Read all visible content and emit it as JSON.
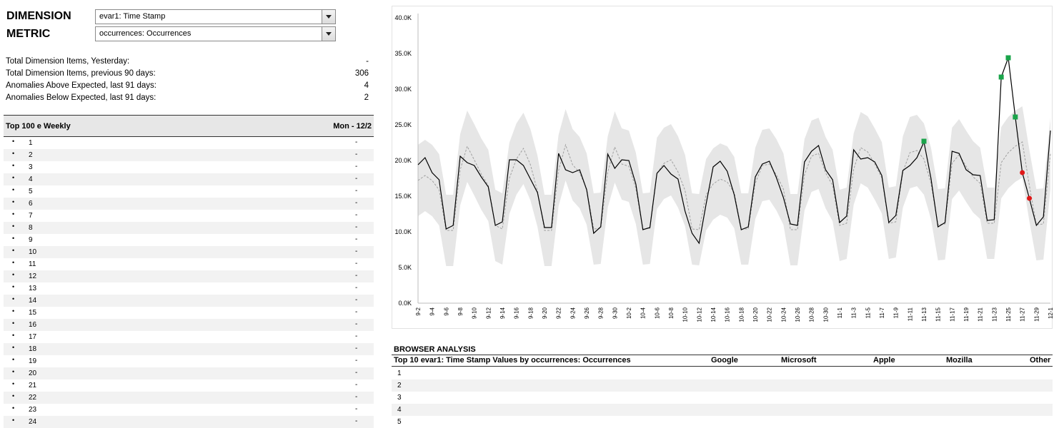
{
  "header": {
    "dimension_label": "DIMENSION",
    "metric_label": "METRIC",
    "dimension_value": "evar1: Time Stamp",
    "metric_value": "occurrences: Occurrences"
  },
  "stats": [
    {
      "label": "Total Dimension Items, Yesterday:",
      "value": "-"
    },
    {
      "label": "Total Dimension Items, previous 90 days:",
      "value": "306"
    },
    {
      "label": "Anomalies Above Expected, last 91 days:",
      "value": "4"
    },
    {
      "label": "Anomalies Below Expected, last 91 days:",
      "value": "2"
    }
  ],
  "top_table": {
    "title": "Top 100 e Weekly",
    "column": "Mon - 12/2",
    "bullet": "•",
    "empty_value": "-",
    "rows": [
      "1",
      "2",
      "3",
      "4",
      "5",
      "6",
      "7",
      "8",
      "9",
      "10",
      "11",
      "12",
      "13",
      "14",
      "15",
      "16",
      "17",
      "18",
      "19",
      "20",
      "21",
      "22",
      "23",
      "24"
    ]
  },
  "chart_data": {
    "type": "line",
    "ylim": [
      0,
      40000
    ],
    "yticks": [
      "0.0K",
      "5.0K",
      "10.0K",
      "15.0K",
      "20.0K",
      "25.0K",
      "30.0K",
      "35.0K",
      "40.0K"
    ],
    "xticks": [
      "9-2",
      "9-4",
      "9-6",
      "9-8",
      "9-10",
      "9-12",
      "9-14",
      "9-16",
      "9-18",
      "9-20",
      "9-22",
      "9-24",
      "9-26",
      "9-28",
      "9-30",
      "10-2",
      "10-4",
      "10-6",
      "10-8",
      "10-10",
      "10-12",
      "10-14",
      "10-16",
      "10-18",
      "10-20",
      "10-22",
      "10-24",
      "10-26",
      "10-28",
      "10-30",
      "11-1",
      "11-3",
      "11-5",
      "11-7",
      "11-9",
      "11-11",
      "11-13",
      "11-15",
      "11-17",
      "11-19",
      "11-21",
      "11-23",
      "11-25",
      "11-27",
      "11-29",
      "12-1"
    ],
    "grid": false,
    "series": [
      {
        "style": "actual",
        "color": "#000000",
        "values": [
          19400,
          20400,
          18300,
          17300,
          10400,
          10900,
          20600,
          19700,
          19300,
          17700,
          16300,
          10900,
          11400,
          20100,
          20100,
          19300,
          17400,
          15500,
          10600,
          10600,
          21000,
          18700,
          18300,
          18700,
          15900,
          9800,
          10700,
          20900,
          18900,
          20100,
          20000,
          16700,
          10300,
          10600,
          18200,
          19300,
          18100,
          17400,
          12900,
          9800,
          8400,
          13900,
          19100,
          19900,
          18500,
          15200,
          10300,
          10700,
          17700,
          19500,
          19900,
          17600,
          14800,
          11100,
          10900,
          19800,
          21300,
          22100,
          18700,
          17300,
          11300,
          12200,
          21500,
          20200,
          20400,
          19800,
          17900,
          11300,
          12300,
          18600,
          19300,
          20400,
          22600,
          17500,
          10700,
          11300,
          21300,
          21000,
          18700,
          18000,
          17900,
          11600,
          11700,
          31700,
          34400,
          26100,
          18300,
          14700,
          10900,
          12100,
          24200
        ]
      },
      {
        "style": "expected",
        "color": "#a0a0a0",
        "values": [
          17200,
          17900,
          17200,
          15900,
          10200,
          10200,
          18700,
          22000,
          20100,
          18100,
          16500,
          10900,
          10400,
          17500,
          20200,
          21700,
          19400,
          15700,
          10200,
          10200,
          18600,
          22200,
          19400,
          18300,
          16000,
          10400,
          10500,
          18400,
          21900,
          19500,
          19200,
          16100,
          10400,
          10500,
          18200,
          19600,
          20100,
          18400,
          15800,
          10400,
          10300,
          15200,
          16700,
          17400,
          17000,
          15500,
          10400,
          10400,
          16800,
          19300,
          19500,
          18000,
          16000,
          10300,
          10300,
          18000,
          20600,
          21000,
          18300,
          16500,
          10900,
          11200,
          18800,
          21800,
          21200,
          19500,
          17600,
          11200,
          11400,
          18400,
          21100,
          21400,
          20200,
          16800,
          11000,
          11100,
          19600,
          20800,
          19200,
          17700,
          16800,
          11200,
          11200,
          19700,
          21100,
          22000,
          22600,
          16500,
          11000,
          11100,
          21000
        ]
      }
    ],
    "band": {
      "color": "#e6e6e6",
      "half_width": 5000
    },
    "anomalies": [
      {
        "x": "11-13",
        "value": 22700,
        "kind": "above",
        "color": "#1aa44a"
      },
      {
        "x": "11-24",
        "value": 31700,
        "kind": "above",
        "color": "#1aa44a"
      },
      {
        "x": "11-25",
        "value": 34400,
        "kind": "above",
        "color": "#1aa44a"
      },
      {
        "x": "11-26",
        "value": 26100,
        "kind": "above",
        "color": "#1aa44a"
      },
      {
        "x": "11-27",
        "value": 18300,
        "kind": "below",
        "color": "#e01818"
      },
      {
        "x": "11-28",
        "value": 14700,
        "kind": "below",
        "color": "#e01818"
      }
    ]
  },
  "browser_analysis": {
    "title": "BROWSER ANALYSIS",
    "table_title": "Top 10 evar1: Time Stamp Values by occurrences: Occurrences",
    "columns": [
      "Google",
      "Microsoft",
      "Apple",
      "Mozilla",
      "Other"
    ],
    "rows": [
      "1",
      "2",
      "3",
      "4",
      "5"
    ]
  }
}
